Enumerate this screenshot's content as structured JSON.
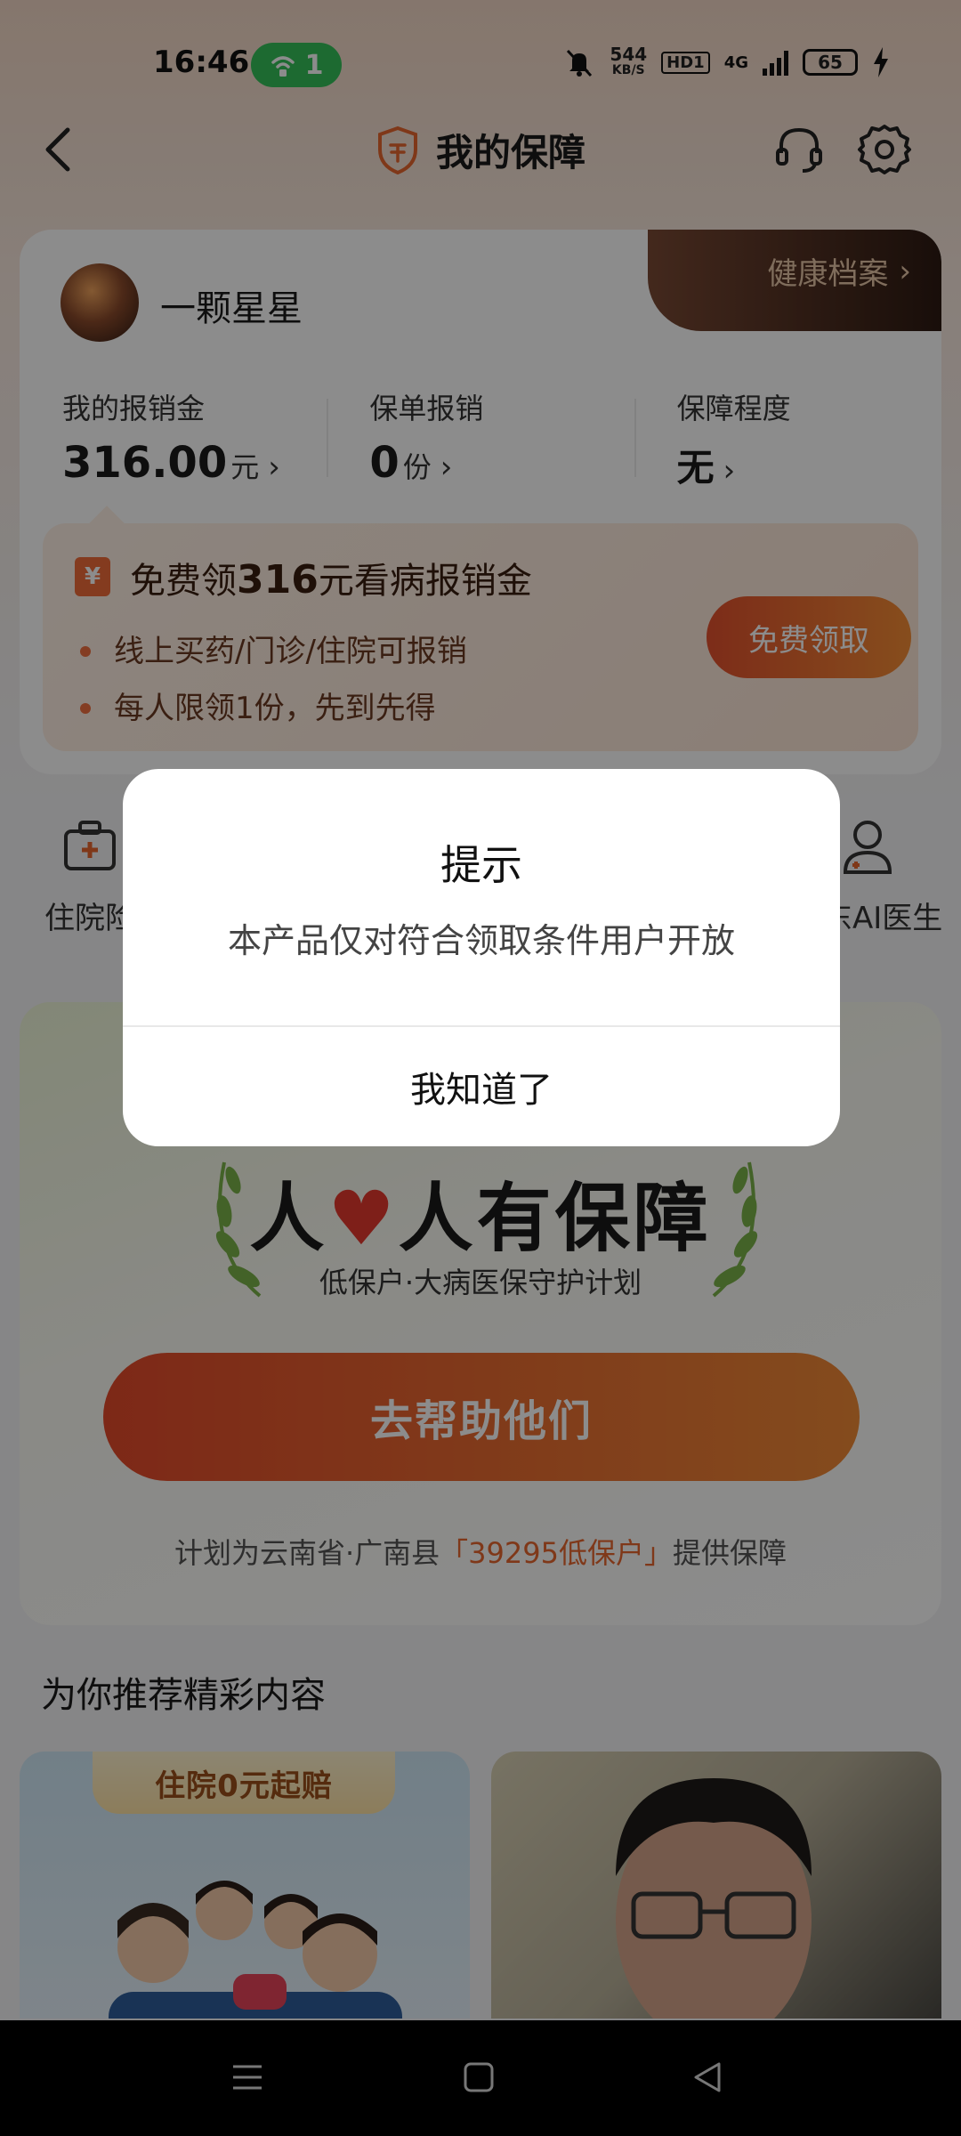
{
  "status_bar": {
    "time": "16:46",
    "hotspot_count": "1",
    "net_speed_value": "544",
    "net_speed_unit": "KB/S",
    "hd_label": "HD1",
    "network_label": "4G",
    "battery": "65"
  },
  "header": {
    "title": "我的保障"
  },
  "profile": {
    "username": "一颗星星",
    "health_record_label": "健康档案"
  },
  "stats": [
    {
      "label": "我的报销金",
      "value": "316.00",
      "unit": "元"
    },
    {
      "label": "保单报销",
      "value": "0",
      "unit": "份"
    },
    {
      "label": "保障程度",
      "value": "无",
      "unit": ""
    }
  ],
  "promo": {
    "icon_glyph": "¥",
    "title_prefix": "免费领",
    "title_amount": "316",
    "title_suffix": "元看病报销金",
    "bullets": [
      "线上买药/门诊/住院可报销",
      "每人限领1份，先到先得"
    ],
    "button_label": "免费领取"
  },
  "services": {
    "left_label": "住院险",
    "right_label": "京东AI医生"
  },
  "banner": {
    "title_a": "人",
    "title_b": "人有保障",
    "subtitle": "低保户·大病医保守护计划",
    "button_label": "去帮助他们",
    "note_prefix": "计划为云南省·广南县",
    "note_highlight": "「39295低保户」",
    "note_suffix": "提供保障"
  },
  "recommend": {
    "section_title": "为你推荐精彩内容",
    "card1_pill": "住院0元起赔"
  },
  "dialog": {
    "title": "提示",
    "message": "本产品仅对符合领取条件用户开放",
    "button_label": "我知道了"
  },
  "colors": {
    "accent_orange": "#e8662e",
    "hotspot_green": "#36c25a",
    "health_tab_dark": "#2d1a12"
  },
  "icons": {
    "back": "back-icon",
    "shield": "shield-icon",
    "service": "headset-icon",
    "settings": "gear-icon",
    "hospital": "medical-kit-icon",
    "doctor": "doctor-icon"
  }
}
